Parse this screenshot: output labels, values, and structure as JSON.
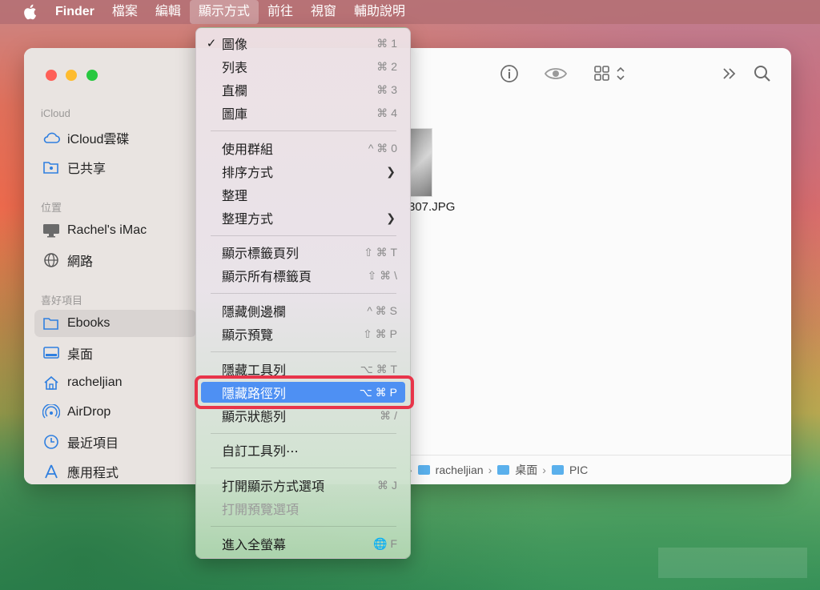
{
  "menubar": {
    "app": "Finder",
    "items": [
      "檔案",
      "編輯",
      "顯示方式",
      "前往",
      "視窗",
      "輔助說明"
    ]
  },
  "sidebar": {
    "sections": [
      {
        "label": "iCloud",
        "items": [
          {
            "label": "iCloud雲碟",
            "icon": "cloud-icon"
          },
          {
            "label": "已共享",
            "icon": "shared-folder-icon"
          }
        ]
      },
      {
        "label": "位置",
        "items": [
          {
            "label": "Rachel's iMac",
            "icon": "imac-icon"
          },
          {
            "label": "網路",
            "icon": "globe-icon"
          }
        ]
      },
      {
        "label": "喜好項目",
        "items": [
          {
            "label": "Ebooks",
            "icon": "folder-icon",
            "selected": true
          },
          {
            "label": "桌面",
            "icon": "desktop-icon"
          },
          {
            "label": "racheljian",
            "icon": "home-icon"
          },
          {
            "label": "AirDrop",
            "icon": "airdrop-icon"
          },
          {
            "label": "最近項目",
            "icon": "clock-icon"
          },
          {
            "label": "應用程式",
            "icon": "applications-icon"
          }
        ]
      }
    ]
  },
  "content": {
    "file_name": "307.JPG"
  },
  "pathbar": {
    "segments": [
      "racheljian",
      "桌面",
      "PIC"
    ]
  },
  "view_menu": {
    "items": [
      {
        "label": "圖像",
        "shortcut": "⌘ 1",
        "checked": true
      },
      {
        "label": "列表",
        "shortcut": "⌘ 2"
      },
      {
        "label": "直欄",
        "shortcut": "⌘ 3"
      },
      {
        "label": "圖庫",
        "shortcut": "⌘ 4"
      },
      {
        "label": "使用群組",
        "shortcut": "^ ⌘ 0"
      },
      {
        "label": "排序方式",
        "submenu": true
      },
      {
        "label": "整理"
      },
      {
        "label": "整理方式",
        "submenu": true
      },
      {
        "label": "顯示標籤頁列",
        "shortcut": "⇧ ⌘ T"
      },
      {
        "label": "顯示所有標籤頁",
        "shortcut": "⇧ ⌘ \\"
      },
      {
        "label": "隱藏側邊欄",
        "shortcut": "^ ⌘ S"
      },
      {
        "label": "顯示預覽",
        "shortcut": "⇧ ⌘ P"
      },
      {
        "label": "隱藏工具列",
        "shortcut": "⌥ ⌘ T"
      },
      {
        "label": "隱藏路徑列",
        "shortcut": "⌥ ⌘ P",
        "highlighted": true
      },
      {
        "label": "顯示狀態列",
        "shortcut": "⌘ /"
      },
      {
        "label": "自訂工具列⋯"
      },
      {
        "label": "打開顯示方式選項",
        "shortcut": "⌘ J"
      },
      {
        "label": "打開預覽選項",
        "disabled": true
      },
      {
        "label": "進入全螢幕",
        "shortcut": "F"
      }
    ]
  },
  "colors": {
    "highlight": "#4e90f3",
    "annotation_box": "#e8354a"
  }
}
